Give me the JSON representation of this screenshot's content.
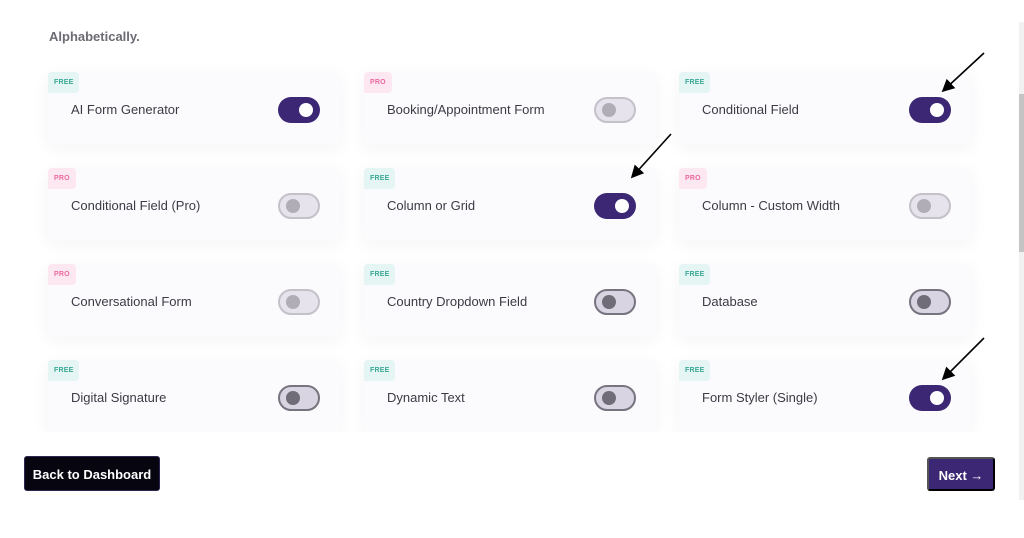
{
  "intro": {
    "text": "Alphabetically."
  },
  "modules": [
    {
      "badge": "FREE",
      "tier": "free",
      "label": "AI Form Generator",
      "state": "on"
    },
    {
      "badge": "PRO",
      "tier": "pro",
      "label": "Booking/Appointment Form",
      "state": "disabled"
    },
    {
      "badge": "FREE",
      "tier": "free",
      "label": "Conditional Field",
      "state": "on"
    },
    {
      "badge": "PRO",
      "tier": "pro",
      "label": "Conditional Field (Pro)",
      "state": "disabled"
    },
    {
      "badge": "FREE",
      "tier": "free",
      "label": "Column or Grid",
      "state": "on"
    },
    {
      "badge": "PRO",
      "tier": "pro",
      "label": "Column - Custom Width",
      "state": "disabled"
    },
    {
      "badge": "PRO",
      "tier": "pro",
      "label": "Conversational Form",
      "state": "disabled"
    },
    {
      "badge": "FREE",
      "tier": "free",
      "label": "Country Dropdown Field",
      "state": "off"
    },
    {
      "badge": "FREE",
      "tier": "free",
      "label": "Database",
      "state": "off"
    },
    {
      "badge": "FREE",
      "tier": "free",
      "label": "Digital Signature",
      "state": "off"
    },
    {
      "badge": "FREE",
      "tier": "free",
      "label": "Dynamic Text",
      "state": "off"
    },
    {
      "badge": "FREE",
      "tier": "free",
      "label": "Form Styler (Single)",
      "state": "on"
    }
  ],
  "footer": {
    "back_label": "Back to Dashboard",
    "next_label": "Next",
    "next_icon": "→"
  },
  "colors": {
    "accent": "#3b2774",
    "free_badge": "#3aa895",
    "pro_badge": "#ea6aa2"
  }
}
